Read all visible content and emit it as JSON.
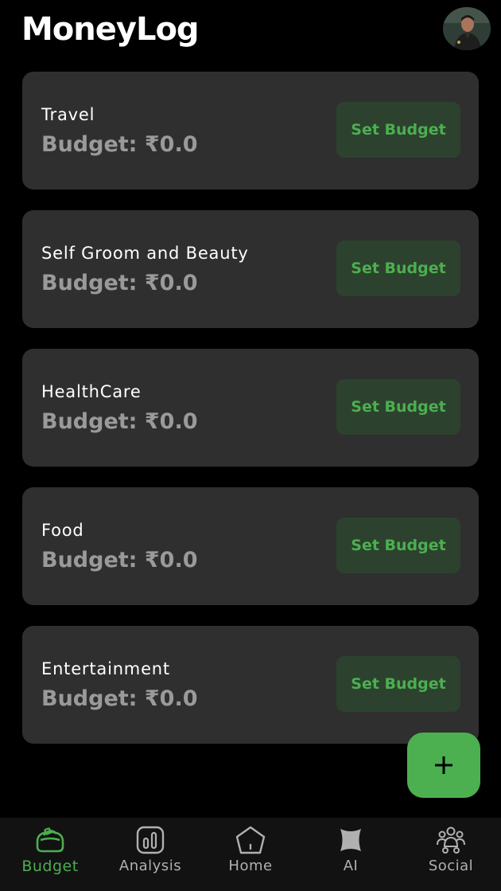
{
  "app": {
    "title": "MoneyLog"
  },
  "colors": {
    "background": "#000000",
    "card": "#2f2f2f",
    "accent": "#4caf50",
    "button_bg": "#2c422e",
    "muted_text": "#9a9a9a",
    "nav_bg": "#121212"
  },
  "categories": [
    {
      "name": "Travel",
      "budget": "Budget: ₹0.0",
      "button": "Set Budget"
    },
    {
      "name": "Self Groom and Beauty",
      "budget": "Budget: ₹0.0",
      "button": "Set Budget"
    },
    {
      "name": "HealthCare",
      "budget": "Budget: ₹0.0",
      "button": "Set Budget"
    },
    {
      "name": "Food",
      "budget": "Budget: ₹0.0",
      "button": "Set Budget"
    },
    {
      "name": "Entertainment",
      "budget": "Budget: ₹0.0",
      "button": "Set Budget"
    }
  ],
  "fab": {
    "icon": "plus-icon"
  },
  "bottom_nav": {
    "active": "Budget",
    "items": [
      {
        "label": "Budget",
        "icon": "budget-icon"
      },
      {
        "label": "Analysis",
        "icon": "analysis-icon"
      },
      {
        "label": "Home",
        "icon": "home-icon"
      },
      {
        "label": "AI",
        "icon": "ai-icon"
      },
      {
        "label": "Social",
        "icon": "social-icon"
      }
    ]
  }
}
